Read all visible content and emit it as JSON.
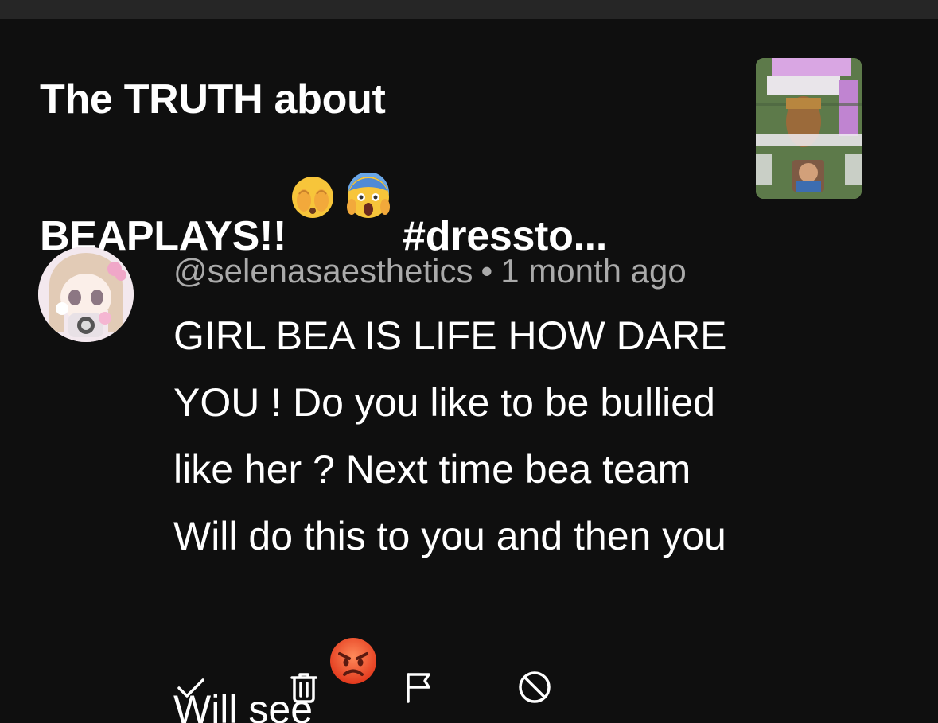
{
  "video": {
    "title": "The TRUTH about\nBEAPLAYS!!",
    "title_tail": " #dressto...",
    "title_emojis": [
      "hand-over-face-emoji",
      "screaming-face-emoji"
    ],
    "thumbnail_icon": "video-thumbnail"
  },
  "comment": {
    "author": "@selenasaesthetics",
    "separator": "•",
    "time": "1 month ago",
    "text": "GIRL BEA IS LIFE HOW DARE\nYOU ! Do you like to be bullied\nlike her ? Next time bea team\nWill do this to you and then you\nWill see",
    "trailing_emoji": "angry-face-emoji"
  },
  "actions": [
    {
      "name": "approve",
      "icon": "checkmark-icon"
    },
    {
      "name": "delete",
      "icon": "trash-icon"
    },
    {
      "name": "report",
      "icon": "flag-icon"
    },
    {
      "name": "block",
      "icon": "block-icon"
    }
  ],
  "colors": {
    "background": "#0f0f0f",
    "top_strip": "#262626",
    "primary_text": "#ffffff",
    "secondary_text": "#aaaaaa"
  }
}
